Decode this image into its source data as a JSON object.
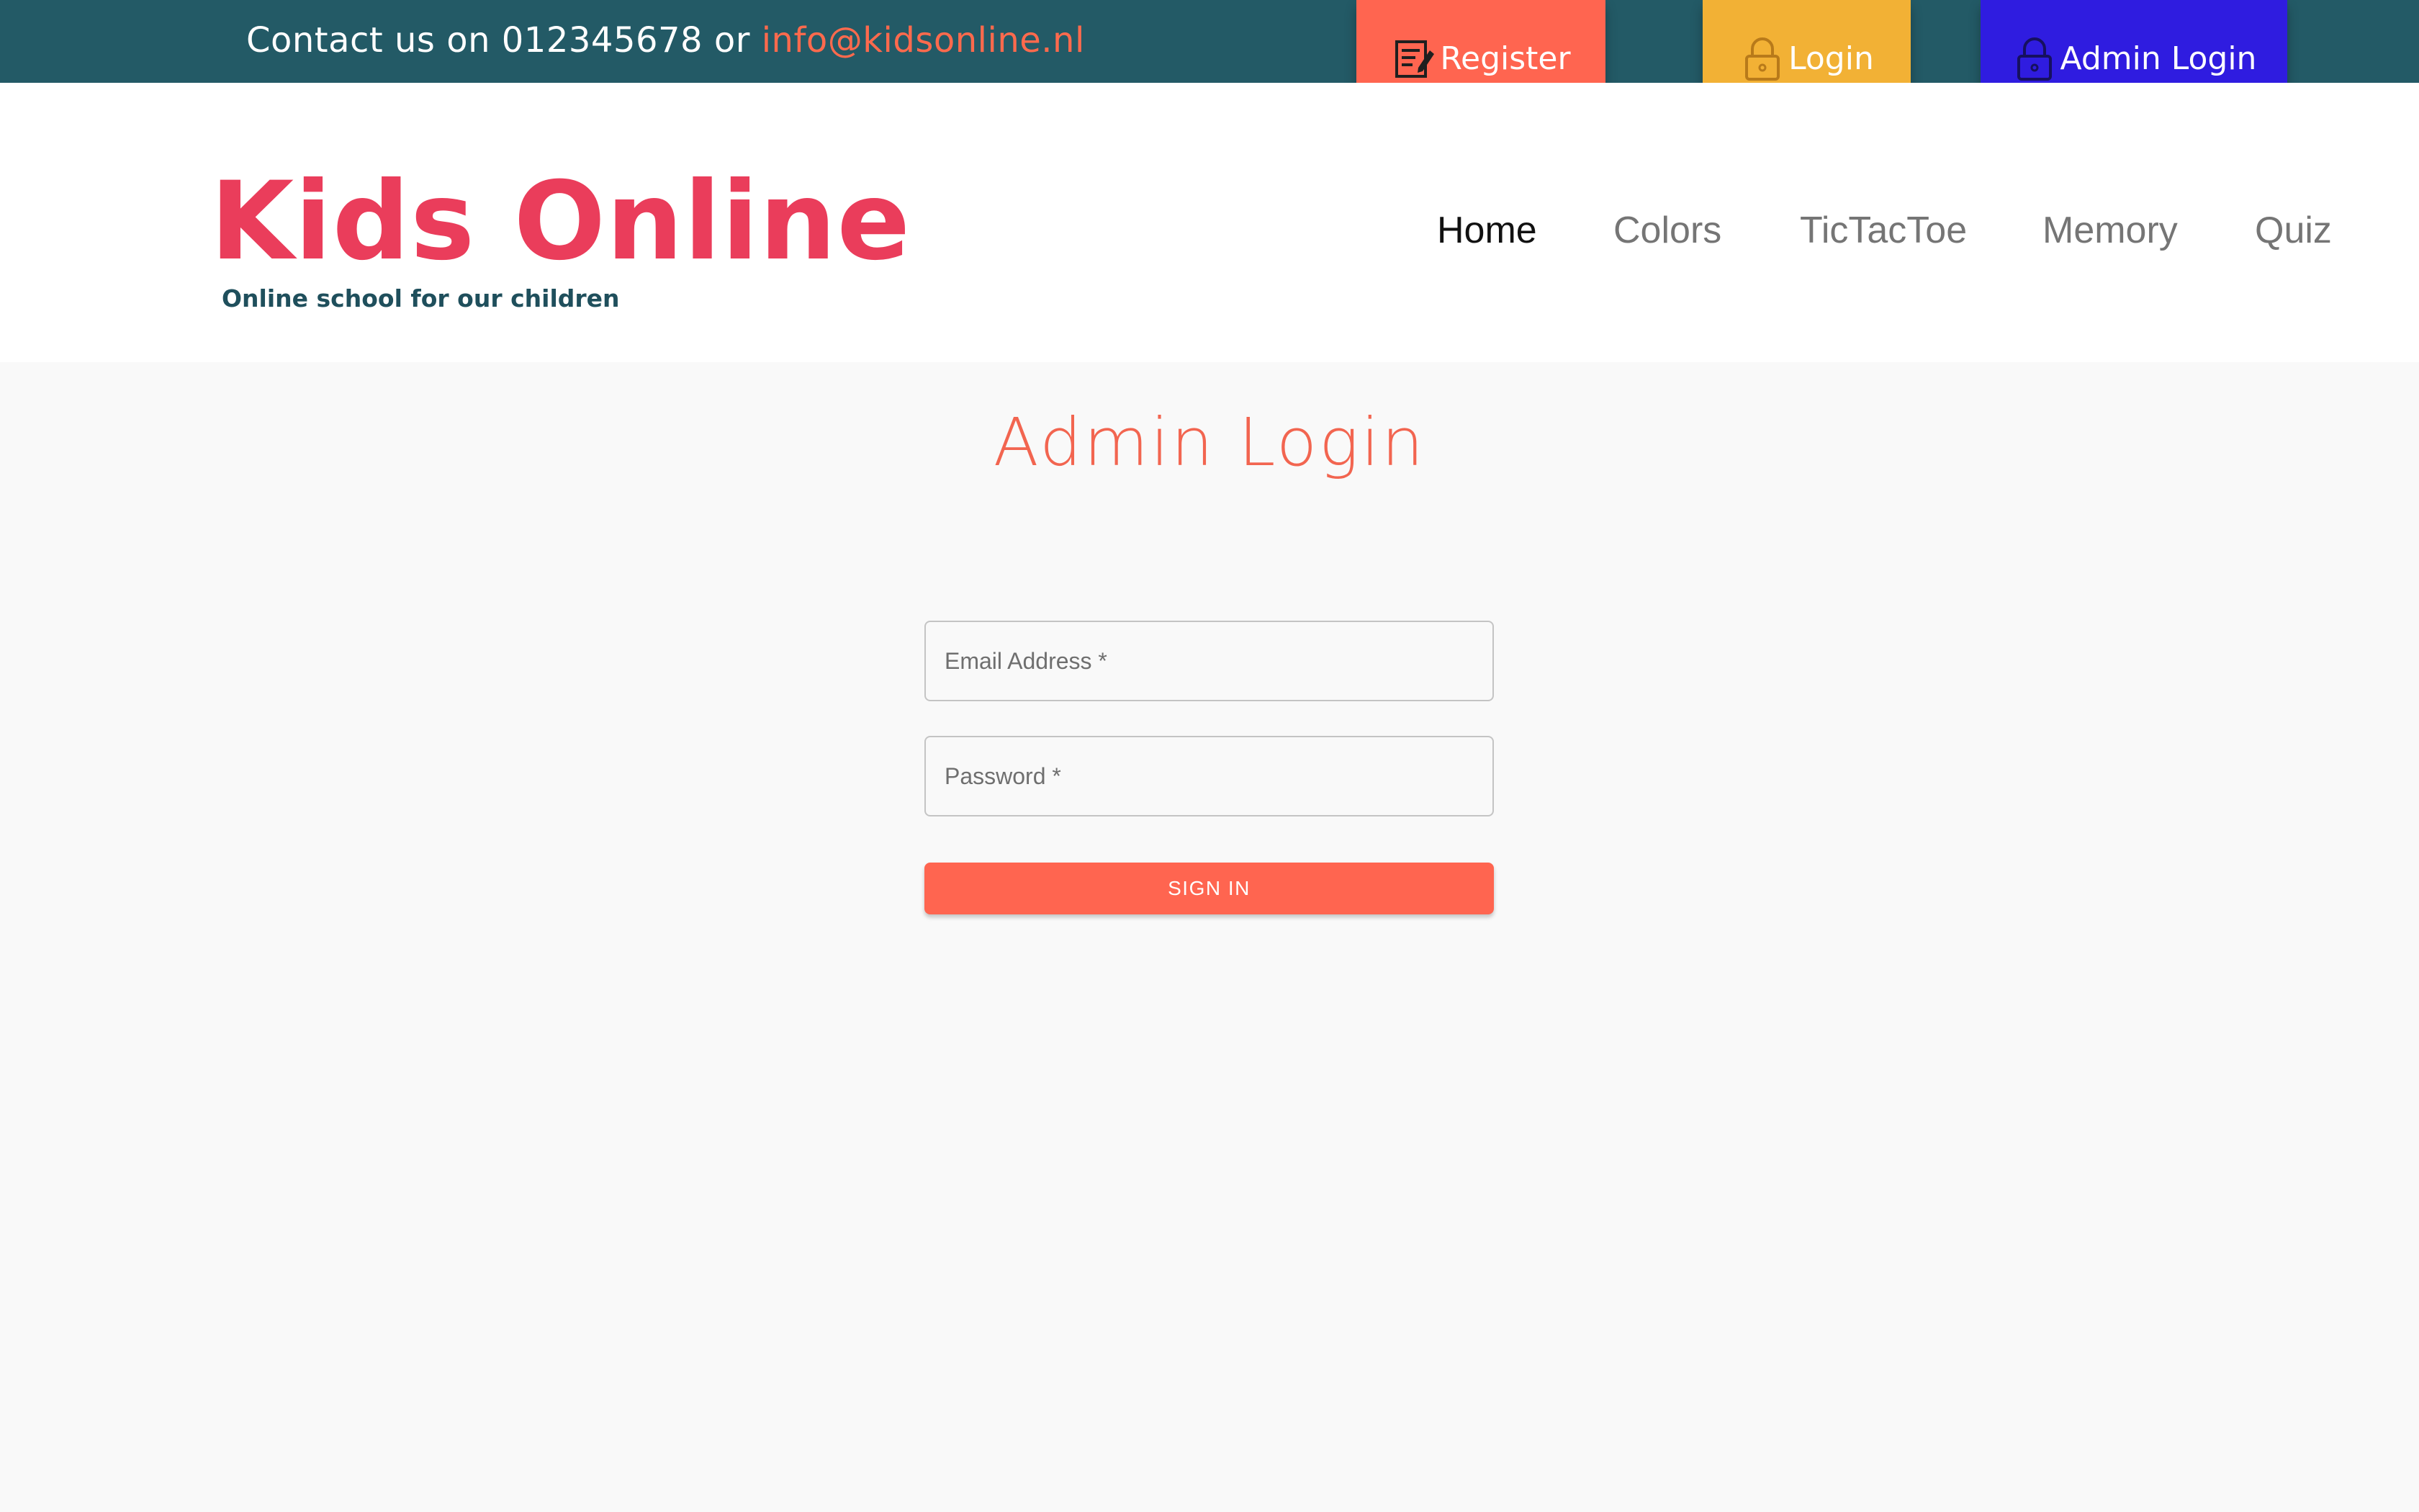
{
  "topbar": {
    "contact_prefix": "Contact us on 012345678 or ",
    "contact_email": "info@kidsonline.nl",
    "buttons": {
      "register": {
        "label": "Register",
        "icon": "register-icon",
        "color": "#ff6550"
      },
      "login": {
        "label": "Login",
        "icon": "lock-icon",
        "color": "#f2b135"
      },
      "admin_login": {
        "label": "Admin Login",
        "icon": "lock-icon",
        "color": "#2f1ce0"
      }
    },
    "background": "#235a66"
  },
  "header": {
    "logo": "Kids Online",
    "tagline": "Online school for our children",
    "logo_color": "#ea3d5b",
    "nav": [
      {
        "label": "Home",
        "active": true
      },
      {
        "label": "Colors",
        "active": false
      },
      {
        "label": "TicTacToe",
        "active": false
      },
      {
        "label": "Memory",
        "active": false
      },
      {
        "label": "Quiz",
        "active": false
      }
    ]
  },
  "main": {
    "title": "Admin Login",
    "form": {
      "email_placeholder": "Email Address *",
      "email_value": "",
      "password_placeholder": "Password *",
      "password_value": "",
      "submit_label": "SIGN IN"
    },
    "accent_color": "#ff6550"
  }
}
